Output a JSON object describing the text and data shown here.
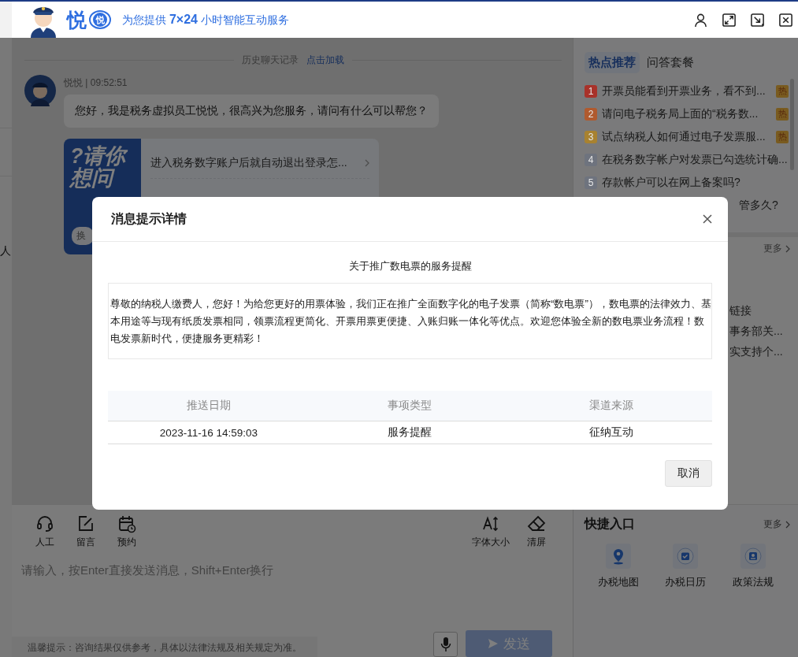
{
  "background_page": {
    "text_fragment": "人"
  },
  "header": {
    "logo_text": "悦",
    "logo_badge": "悦",
    "tagline": "为您提供 **7×24** 小时智能互动服务"
  },
  "chat": {
    "history_label": "历史聊天记录",
    "history_link": "点击加载",
    "messages": [
      {
        "sender": "悦悦 | 09:52:51",
        "text": "您好，我是税务虚拟员工悦悦，很高兴为您服务，请问有什么可以帮您？"
      }
    ],
    "suggest_card": {
      "banner": "?请你想问",
      "refresh": "换",
      "questions": [
        "进入税务数字账户后就自动退出登录怎..."
      ]
    }
  },
  "side": {
    "tabs": [
      {
        "label": "热点推荐",
        "selected": true
      },
      {
        "label": "问答套餐",
        "selected": false
      }
    ],
    "hot_items": [
      {
        "rank": "1",
        "text": "开票员能看到开票业务，看不到...",
        "badge": "热",
        "color": "#a8322a"
      },
      {
        "rank": "2",
        "text": "请问电子税务局上面的“税务数...",
        "badge": "热",
        "color": "#b05a2e"
      },
      {
        "rank": "3",
        "text": "试点纳税人如何通过电子发票服...",
        "badge": "热",
        "color": "#a88230"
      },
      {
        "rank": "4",
        "text": "在税务数字帐户对发票已勾选统计确...",
        "color": "#6e737e"
      },
      {
        "rank": "5",
        "text": "存款帐户可以在网上备案吗?",
        "color": "#6e737e"
      }
    ],
    "hot_item_fragment": "管多久?",
    "more": "更多",
    "section2_fragments": [
      "链接",
      "事务部关...",
      "实支持个..."
    ]
  },
  "composer": {
    "tools_left": [
      {
        "label": "人工"
      },
      {
        "label": "留言"
      },
      {
        "label": "预约"
      }
    ],
    "tools_right": [
      {
        "label": "字体大小"
      },
      {
        "label": "清屏"
      }
    ],
    "placeholder": "请输入，按Enter直接发送消息，Shift+Enter换行",
    "tip": "温馨提示：咨询结果仅供参考，具体以法律法规及相关规定为准。",
    "send": "发送"
  },
  "quick_entry": {
    "title": "快捷入口",
    "more": "更多",
    "items": [
      {
        "label": "办税地图"
      },
      {
        "label": "办税日历"
      },
      {
        "label": "政策法规"
      }
    ]
  },
  "modal": {
    "title": "消息提示详情",
    "subtitle": "关于推广数电票的服务提醒",
    "body": "尊敬的纳税人缴费人，您好！为给您更好的用票体验，我们正在推广全面数字化的电子发票（简称“数电票”），数电票的法律效力、基本用途等与现有纸质发票相同，领票流程更简化、开票用票更便捷、入账归账一体化等优点。欢迎您体验全新的数电票业务流程！数电发票新时代，便捷服务更精彩！",
    "table": {
      "columns": [
        "推送日期",
        "事项类型",
        "渠道来源"
      ],
      "rows": [
        [
          "2023-11-16 14:59:03",
          "服务提醒",
          "征纳互动"
        ]
      ]
    },
    "cancel": "取消"
  }
}
